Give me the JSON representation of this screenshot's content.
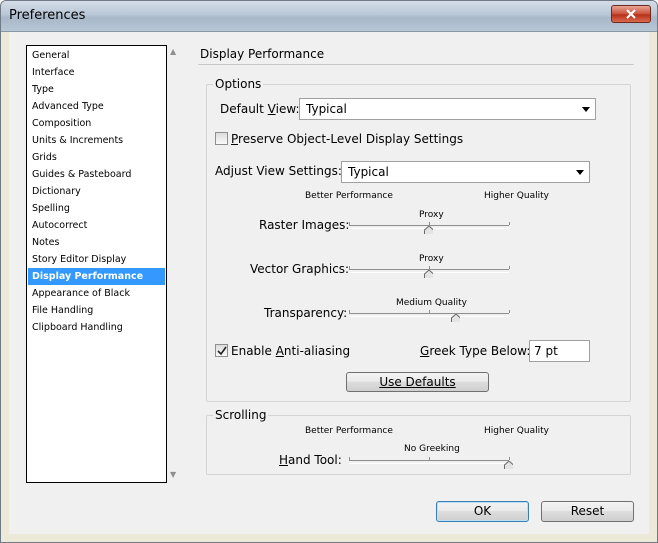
{
  "window": {
    "title": "Preferences"
  },
  "categories": [
    {
      "label": "General",
      "selected": false
    },
    {
      "label": "Interface",
      "selected": false
    },
    {
      "label": "Type",
      "selected": false
    },
    {
      "label": "Advanced Type",
      "selected": false
    },
    {
      "label": "Composition",
      "selected": false
    },
    {
      "label": "Units & Increments",
      "selected": false
    },
    {
      "label": "Grids",
      "selected": false
    },
    {
      "label": "Guides & Pasteboard",
      "selected": false
    },
    {
      "label": "Dictionary",
      "selected": false
    },
    {
      "label": "Spelling",
      "selected": false
    },
    {
      "label": "Autocorrect",
      "selected": false
    },
    {
      "label": "Notes",
      "selected": false
    },
    {
      "label": "Story Editor Display",
      "selected": false
    },
    {
      "label": "Display Performance",
      "selected": true
    },
    {
      "label": "Appearance of Black",
      "selected": false
    },
    {
      "label": "File Handling",
      "selected": false
    },
    {
      "label": "Clipboard Handling",
      "selected": false
    }
  ],
  "panel": {
    "title": "Display Performance",
    "options": {
      "group_label": "Options",
      "default_view_label": "Default View:",
      "default_view_value": "Typical",
      "preserve_label": "Preserve Object-Level Display Settings",
      "preserve_checked": false,
      "adjust_view_label": "Adjust View Settings:",
      "adjust_view_value": "Typical",
      "better_performance": "Better Performance",
      "higher_quality": "Higher Quality",
      "raster_label": "Raster Images:",
      "raster_value": "Proxy",
      "raster_level": 0.5,
      "vector_label": "Vector Graphics:",
      "vector_value": "Proxy",
      "vector_level": 0.5,
      "transparency_label": "Transparency:",
      "transparency_value": "Medium Quality",
      "transparency_level": 0.667,
      "antialias_label": "Enable Anti-aliasing",
      "antialias_checked": true,
      "greek_label": "Greek Type Below:",
      "greek_value": "7 pt",
      "use_defaults": "Use Defaults"
    },
    "scrolling": {
      "group_label": "Scrolling",
      "better_performance": "Better Performance",
      "higher_quality": "Higher Quality",
      "hand_tool_label": "Hand Tool:",
      "hand_tool_value": "No Greeking",
      "hand_tool_level": 1.0
    }
  },
  "footer": {
    "ok": "OK",
    "reset": "Reset"
  }
}
